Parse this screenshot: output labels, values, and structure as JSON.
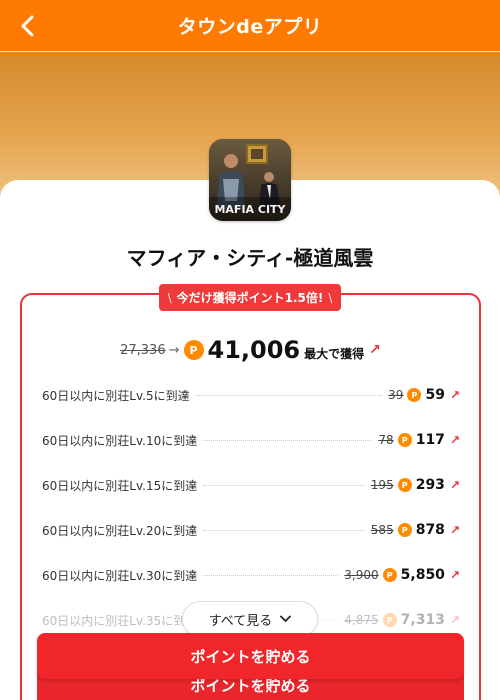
{
  "header": {
    "title": "タウンdeアプリ",
    "back_icon": "chevron-left-icon"
  },
  "app": {
    "name": "マフィア・シティ-極道風雲",
    "icon_text": "MAFIA CITY"
  },
  "promo": {
    "left": "\\",
    "text": "今だけ獲得ポイント1.5倍!",
    "right": "\\"
  },
  "total": {
    "old": "27,336",
    "arrow": "→",
    "coin": "P",
    "new": "41,006",
    "suffix": "最大で獲得",
    "up": "↗"
  },
  "tasks": [
    {
      "label": "60日以内に別荘Lv.5に到達",
      "old": "39",
      "new": "59"
    },
    {
      "label": "60日以内に別荘Lv.10に到達",
      "old": "78",
      "new": "117"
    },
    {
      "label": "60日以内に別荘Lv.15に到達",
      "old": "195",
      "new": "293"
    },
    {
      "label": "60日以内に別荘Lv.20に到達",
      "old": "585",
      "new": "878"
    },
    {
      "label": "60日以内に別荘Lv.30に到達",
      "old": "3,900",
      "new": "5,850"
    },
    {
      "label": "60日以内に別荘Lv.35に到達",
      "old": "4,875",
      "new": "7,313"
    }
  ],
  "coin_letter": "P",
  "up_arrow": "↗",
  "see_all": "すべて見る",
  "cta": {
    "label": "ポイントを貯める"
  },
  "colors": {
    "header": "#ff7a00",
    "accent_red": "#e8333a",
    "coin": "#ff8a00",
    "cta": "#f0262b"
  }
}
